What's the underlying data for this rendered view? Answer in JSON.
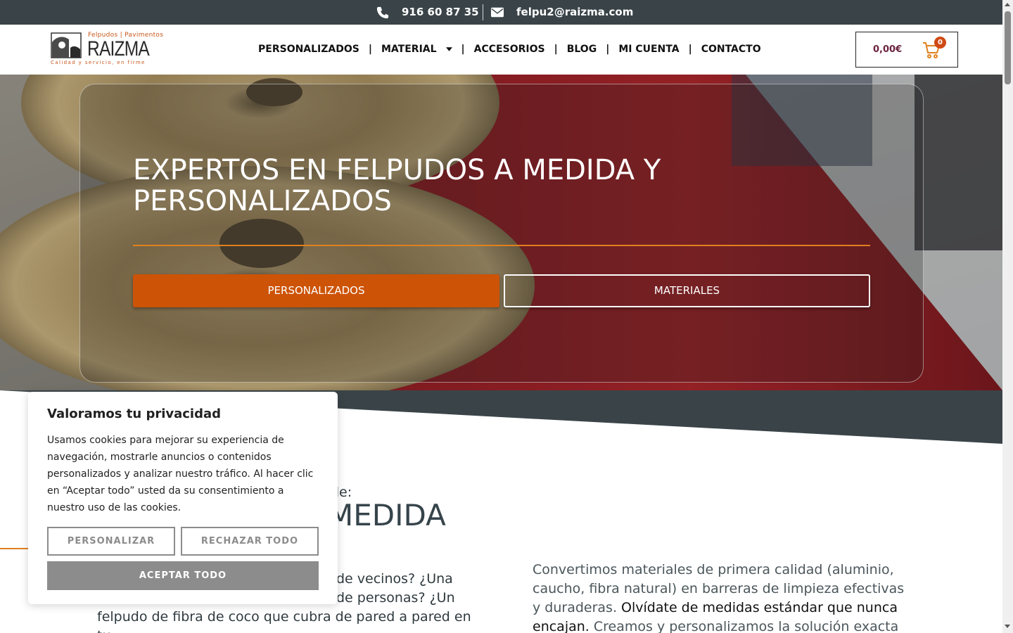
{
  "topbar": {
    "phone": "916 60 87 35",
    "email": "felpu2@raizma.com"
  },
  "logo": {
    "top_line": "Felpudos | Pavimentos",
    "brand": "RAIZMA",
    "tagline": "Calidad y servicio, en firme"
  },
  "nav": {
    "items": [
      "PERSONALIZADOS",
      "MATERIAL",
      "ACCESORIOS",
      "BLOG",
      "MI CUENTA",
      "CONTACTO"
    ],
    "separator": "|"
  },
  "cart": {
    "amount": "0,00€",
    "count": "0"
  },
  "hero": {
    "title": "EXPERTOS EN FELPUDOS A MEDIDA Y PERSONALIZADOS",
    "btn_primary": "PERSONALIZADOS",
    "btn_secondary": "MATERIALES"
  },
  "content": {
    "pre_title": "de:",
    "title": "MEDIDA",
    "left_text": "de vecinos? ¿Una de personas? ¿Un felpudo de fibra de coco que cubra de pared a pared en tu",
    "left_line1": "de vecinos? ¿Una",
    "left_line2": "de personas? ¿Un",
    "left_line3": "felpudo de fibra de coco que cubra de pared a pared en tu",
    "right_text_a": "Convertimos materiales de primera calidad (aluminio, caucho, fibra natural) en barreras de limpieza efectivas y duraderas.",
    "right_text_b": "Olvídate de medidas estándar que nunca encajan.",
    "right_text_c": "Creamos y personalizamos la solución exacta"
  },
  "cookie": {
    "title": "Valoramos tu privacidad",
    "body": "Usamos cookies para mejorar su experiencia de navegación, mostrarle anuncios o contenidos personalizados y analizar nuestro tráfico. Al hacer clic en “Aceptar todo” usted da su consentimiento a nuestro uso de las cookies.",
    "btn_customize": "PERSONALIZAR",
    "btn_reject": "RECHAZAR TODO",
    "btn_accept": "ACEPTAR TODO"
  },
  "colors": {
    "topbar": "#3a4448",
    "accent_orange": "#cd5306",
    "cart_amount": "#6b2440",
    "cookie_gray": "#8c8c8c"
  },
  "icons": [
    "phone-icon",
    "mail-icon",
    "chevron-down-icon",
    "cart-icon"
  ]
}
